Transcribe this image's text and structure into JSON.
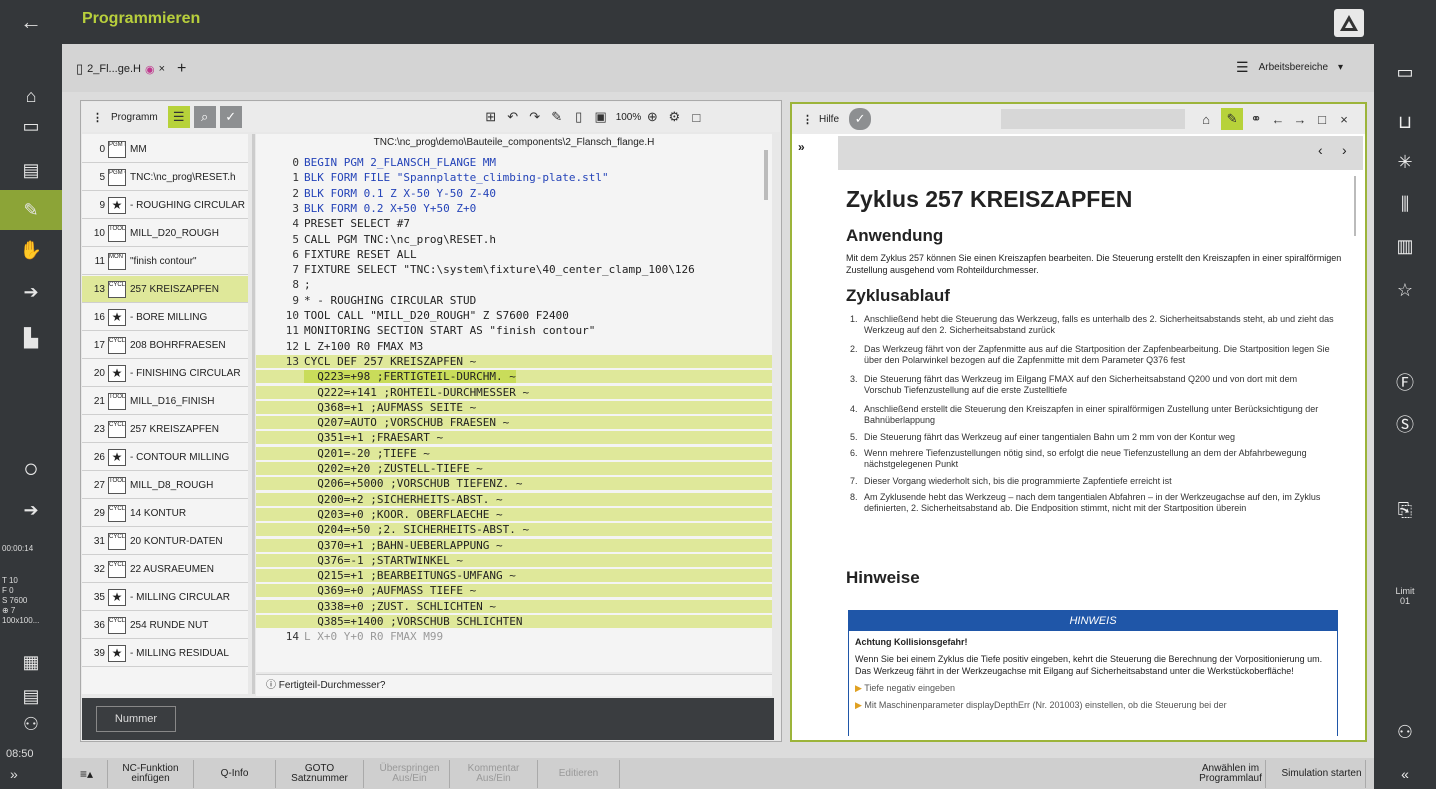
{
  "header": {
    "title": "Programmieren"
  },
  "tab": {
    "filename": "2_Fl...ge.H",
    "close": "×",
    "add": "+"
  },
  "workspaces": {
    "label": "Arbeitsbereiche",
    "menu": "☰",
    "arrow": "▾"
  },
  "program_panel": {
    "label": "Programm",
    "zoom": "100%",
    "path": "TNC:\\nc_prog\\demo\\Bauteile_components\\2_Flansch_flange.H",
    "status": "Fertigteil-Durchmesser?"
  },
  "program_list": [
    {
      "num": "0",
      "icon": "PGM BEGIN",
      "text": "MM"
    },
    {
      "num": "5",
      "icon": "PGM CALL",
      "text": "TNC:\\nc_prog\\RESET.h"
    },
    {
      "num": "9",
      "icon": "★",
      "text": "- ROUGHING CIRCULAR"
    },
    {
      "num": "10",
      "icon": "TOOL CALL",
      "text": "MILL_D20_ROUGH"
    },
    {
      "num": "11",
      "icon": "MON START",
      "text": "\"finish contour\""
    },
    {
      "num": "13",
      "icon": "CYCL DEF",
      "text": "257 KREISZAPFEN",
      "selected": true
    },
    {
      "num": "16",
      "icon": "★",
      "text": "- BORE MILLING"
    },
    {
      "num": "17",
      "icon": "CYCL DEF",
      "text": "208 BOHRFRAESEN"
    },
    {
      "num": "20",
      "icon": "★",
      "text": "- FINISHING CIRCULAR"
    },
    {
      "num": "21",
      "icon": "TOOL CALL",
      "text": "MILL_D16_FINISH"
    },
    {
      "num": "23",
      "icon": "CYCL DEF",
      "text": "257 KREISZAPFEN"
    },
    {
      "num": "26",
      "icon": "★",
      "text": "- CONTOUR MILLING"
    },
    {
      "num": "27",
      "icon": "TOOL CALL",
      "text": "MILL_D8_ROUGH"
    },
    {
      "num": "29",
      "icon": "CYCL DEF",
      "text": "14 KONTUR"
    },
    {
      "num": "31",
      "icon": "CYCL DEF",
      "text": "20 KONTUR-DATEN"
    },
    {
      "num": "32",
      "icon": "CYCL DEF",
      "text": "22 AUSRAEUMEN"
    },
    {
      "num": "35",
      "icon": "★",
      "text": "- MILLING CIRCULAR"
    },
    {
      "num": "36",
      "icon": "CYCL DEF",
      "text": "254 RUNDE NUT"
    },
    {
      "num": "39",
      "icon": "★",
      "text": "- MILLING RESIDUAL"
    }
  ],
  "code_lines": [
    {
      "n": "0",
      "t": "BEGIN PGM 2_FLANSCH_FLANGE MM"
    },
    {
      "n": "1",
      "t": "BLK FORM FILE \"Spannplatte_climbing-plate.stl\""
    },
    {
      "n": "2",
      "t": "BLK FORM 0.1 Z X-50 Y-50 Z-40"
    },
    {
      "n": "3",
      "t": "BLK FORM 0.2 X+50 Y+50 Z+0"
    },
    {
      "n": "4",
      "t": "PRESET SELECT #7"
    },
    {
      "n": "5",
      "t": "CALL PGM TNC:\\nc_prog\\RESET.h"
    },
    {
      "n": "6",
      "t": "FIXTURE RESET ALL"
    },
    {
      "n": "7",
      "t": "FIXTURE SELECT \"TNC:\\system\\fixture\\40_center_clamp_100\\126"
    },
    {
      "n": "8",
      "t": ";"
    },
    {
      "n": "9",
      "t": "* - ROUGHING CIRCULAR STUD"
    },
    {
      "n": "10",
      "t": "TOOL CALL \"MILL_D20_ROUGH\" Z S7600 F2400"
    },
    {
      "n": "11",
      "t": "MONITORING SECTION START AS \"finish contour\""
    },
    {
      "n": "12",
      "t": "L Z+100 R0 FMAX M3"
    },
    {
      "n": "13",
      "t": "CYCL DEF 257 KREISZAPFEN ~"
    },
    {
      "n": "",
      "t": "  Q223=+98 ;FERTIGTEIL-DURCHM. ~"
    },
    {
      "n": "",
      "t": "  Q222=+141 ;ROHTEIL-DURCHMESSER ~"
    },
    {
      "n": "",
      "t": "  Q368=+1 ;AUFMASS SEITE ~"
    },
    {
      "n": "",
      "t": "  Q207=AUTO ;VORSCHUB FRAESEN ~"
    },
    {
      "n": "",
      "t": "  Q351=+1 ;FRAESART ~"
    },
    {
      "n": "",
      "t": "  Q201=-20 ;TIEFE ~"
    },
    {
      "n": "",
      "t": "  Q202=+20 ;ZUSTELL-TIEFE ~"
    },
    {
      "n": "",
      "t": "  Q206=+5000 ;VORSCHUB TIEFENZ. ~"
    },
    {
      "n": "",
      "t": "  Q200=+2 ;SICHERHEITS-ABST. ~"
    },
    {
      "n": "",
      "t": "  Q203=+0 ;KOOR. OBERFLAECHE ~"
    },
    {
      "n": "",
      "t": "  Q204=+50 ;2. SICHERHEITS-ABST. ~"
    },
    {
      "n": "",
      "t": "  Q370=+1 ;BAHN-UEBERLAPPUNG ~"
    },
    {
      "n": "",
      "t": "  Q376=-1 ;STARTWINKEL ~"
    },
    {
      "n": "",
      "t": "  Q215=+1 ;BEARBEITUNGS-UMFANG ~"
    },
    {
      "n": "",
      "t": "  Q369=+0 ;AUFMASS TIEFE ~"
    },
    {
      "n": "",
      "t": "  Q338=+0 ;ZUST. SCHLICHTEN ~"
    },
    {
      "n": "",
      "t": "  Q385=+1400 ;VORSCHUB SCHLICHTEN"
    },
    {
      "n": "14",
      "t": "L X+0 Y+0 R0 FMAX M99"
    }
  ],
  "help": {
    "label": "Hilfe",
    "title": "Zyklus 257 KREISZAPFEN",
    "h_anwendung": "Anwendung",
    "p_anwendung": "Mit dem Zyklus 257 können Sie einen Kreiszapfen bearbeiten. Die Steuerung erstellt den Kreiszapfen in einer spiralförmigen Zustellung ausgehend vom Rohteildurchmesser.",
    "h_ablauf": "Zyklusablauf",
    "steps": [
      "Anschließend hebt die Steuerung das Werkzeug, falls es unterhalb des 2. Sicherheitsabstands steht, ab und zieht das Werkzeug auf den 2. Sicherheitsabstand zurück",
      "Das Werkzeug fährt von der Zapfenmitte aus auf die Startposition der Zapfenbearbeitung. Die Startposition legen Sie über den Polarwinkel bezogen auf die Zapfenmitte mit dem Parameter Q376 fest",
      "Die Steuerung fährt das Werkzeug im Eilgang FMAX auf den Sicherheitsabstand Q200 und von dort mit dem Vorschub Tiefenzustellung auf die erste Zustelltiefe",
      "Anschließend erstellt die Steuerung den Kreiszapfen in einer spiralförmigen Zustellung unter Berücksichtigung der Bahnüberlappung",
      "Die Steuerung fährt das Werkzeug auf einer tangentialen Bahn um 2 mm von der Kontur weg",
      "Wenn mehrere Tiefenzustellungen nötig sind, so erfolgt die neue Tiefenzustellung an dem der Abfahrbewegung nächstgelegenen Punkt",
      "Dieser Vorgang wiederholt sich, bis die programmierte Zapfentiefe erreicht ist",
      "Am Zyklusende hebt das Werkzeug – nach dem tangentialen Abfahren – in der Werkzeugachse auf den, im Zyklus definierten, 2. Sicherheitsabstand ab. Die Endposition stimmt, nicht mit der Startposition überein"
    ],
    "h_hinweise": "Hinweise",
    "notice_header": "HINWEIS",
    "notice_title": "Achtung Kollisionsgefahr!",
    "notice_text": "Wenn Sie bei einem Zyklus die Tiefe positiv eingeben, kehrt die Steuerung die Berechnung der Vorpositionierung um. Das Werkzeug fährt in der Werkzeugachse mit Eilgang auf Sicherheitsabstand unter die Werkstückoberfläche!",
    "bullet1": "Tiefe negativ eingeben",
    "bullet2": "Mit Maschinenparameter displayDepthErr (Nr. 201003) einstellen, ob die Steuerung bei der"
  },
  "left_status": {
    "time1": "00:00:14",
    "t": "T 10",
    "f": "F 0",
    "s": "S 7600",
    "p": "⊕ 7",
    "scale": "100x100...",
    "clock": "08:50",
    "expand": "»"
  },
  "right_status": {
    "limit": "Limit 01",
    "collapse": "«"
  },
  "nummer_button": "Nummer",
  "bottom_buttons": [
    {
      "label": "NC-Funktion einfügen",
      "dim": false
    },
    {
      "label": "Q-Info",
      "dim": false
    },
    {
      "label": "GOTO Satznummer",
      "dim": false
    },
    {
      "label": "Überspringen Aus/Ein",
      "dim": true
    },
    {
      "label": "Kommentar Aus/Ein",
      "dim": true
    },
    {
      "label": "Editieren",
      "dim": true
    },
    {
      "label": "Anwählen im Programmlauf",
      "dim": false
    },
    {
      "label": "Simulation starten",
      "dim": false
    }
  ],
  "colors": {
    "accent": "#b8cf3c",
    "highlight": "#dfe89a",
    "notice": "#1f56a8"
  }
}
